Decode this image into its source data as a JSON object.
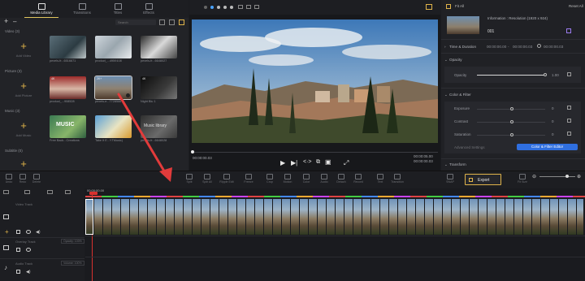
{
  "library": {
    "tabs": [
      {
        "label": "Media Library"
      },
      {
        "label": "Transitions"
      },
      {
        "label": "Titles"
      },
      {
        "label": "Effects"
      }
    ],
    "search_placeholder": "Search",
    "sections": [
      {
        "title": "Video (3)",
        "add_label": "Add Video",
        "items": [
          "pexels-fr...6516671",
          "product_...4959108",
          "pexels-fr...6648027"
        ]
      },
      {
        "title": "Picture (3)",
        "add_label": "Add Picture",
        "items": [
          "product_...908528",
          "pexels-e...7728566",
          "Night Blu 1"
        ],
        "badges": [
          "4K",
          "2K+",
          "4K"
        ]
      },
      {
        "title": "Music (3)",
        "add_label": "Add Music",
        "items": [
          "Free Back...Creations",
          "Take It E...YTMusic)",
          "pexels-fr...6648028"
        ]
      },
      {
        "title": "Subtitle (0)",
        "add_label": "Add Subtitle"
      }
    ]
  },
  "preview": {
    "time_current": "00:00:00.03",
    "time_total": "00:00:05.00",
    "time_right": "00:00:00.03"
  },
  "properties": {
    "fit_all": "Fit All",
    "reset_all": "Reset All",
    "info": "Information : Resolution (1920 x 924)",
    "clip_no": "001",
    "time_duration_label": "Time & Duration",
    "td_start": "00:00:00.00",
    "td_end": "00:00:00.03",
    "td_dur": "00:00:00.03",
    "opacity_label": "Opacity",
    "opacity_name": "Opacity",
    "opacity_value": "1.00",
    "color_label": "Color & Filter",
    "exposure": "Exposure",
    "contrast": "Contrast",
    "saturation": "Saturation",
    "exp_val": "0",
    "con_val": "0",
    "sat_val": "0",
    "advanced": "Advanced Settings",
    "editor_button": "Color & Filter Editor",
    "transform_label": "Transform"
  },
  "toolbar": {
    "undo": "Undo",
    "redo": "Redo",
    "delete": "Delete",
    "tools": [
      "Split",
      "Split All",
      "Ripple Edit",
      "Freeze",
      "Crop",
      "Motion",
      "Color",
      "Audio",
      "Detach",
      "Record",
      "Text",
      "Transition"
    ],
    "snap": "SNAP",
    "export": "Export",
    "fit_size": "Fit Size"
  },
  "timeline": {
    "ruler_time": "00:00:00.00",
    "video_track": "Video Track",
    "overlay_track": "Overlay Track",
    "audio_track": "Audio Track",
    "opacity_badge": "Opacity: 100%",
    "volume_badge": "Volume: 100%"
  },
  "colors": {
    "accent": "#e0b44a",
    "blue_button": "#2f6fe0",
    "arrow": "#e23b3b"
  }
}
